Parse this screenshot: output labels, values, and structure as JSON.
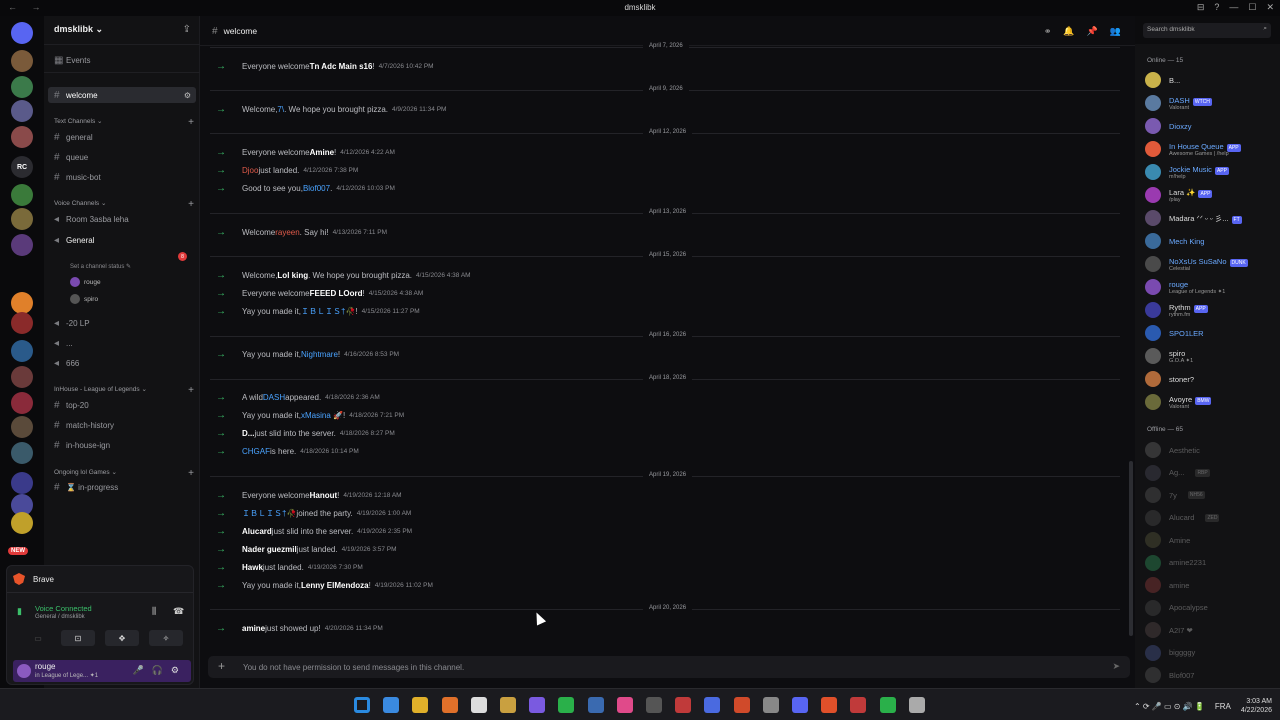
{
  "window": {
    "title": "dmsklibk",
    "nav": "← →",
    "controls": [
      "⊟",
      "?",
      "—",
      "☐",
      "✕"
    ]
  },
  "server": {
    "name": "dmsklibk ⌄",
    "new_badge": "NEW"
  },
  "server_icons": [
    {
      "label": "",
      "color": "#5865f2",
      "badge": ""
    },
    {
      "label": "",
      "color": "#7a5a3a",
      "badge": "4"
    },
    {
      "label": "",
      "color": "#3b7a4a",
      "badge": "7"
    },
    {
      "label": "",
      "color": "#5a5a8a",
      "badge": "6"
    },
    {
      "label": "",
      "color": "#8a4a4a",
      "badge": "4"
    },
    {
      "label": "RC",
      "color": "#2b2b30",
      "badge": ""
    },
    {
      "label": "",
      "color": "#3a7a3a",
      "badge": "1"
    },
    {
      "label": "",
      "color": "#7a6a3a",
      "badge": "3"
    },
    {
      "label": "",
      "color": "#5a3a7a",
      "badge": "1"
    },
    {
      "label": "",
      "color": "#e0802a",
      "badge": ""
    },
    {
      "label": "",
      "color": "#8a2a2a",
      "badge": "30"
    },
    {
      "label": "",
      "color": "#2a5a8a",
      "badge": "6"
    },
    {
      "label": "",
      "color": "#6a3a3a",
      "badge": "3"
    },
    {
      "label": "",
      "color": "#8a2a3a",
      "badge": "3"
    },
    {
      "label": "",
      "color": "#5a4a3a",
      "badge": "3"
    },
    {
      "label": "",
      "color": "#3a5a6a",
      "badge": "1"
    },
    {
      "label": "",
      "color": "#3a3a8a",
      "badge": "37"
    },
    {
      "label": "",
      "color": "#4a4a9a",
      "badge": "30"
    },
    {
      "label": "",
      "color": "#c0a02a",
      "badge": ""
    }
  ],
  "channels": {
    "events": "Events",
    "welcome": "welcome",
    "text_cat": "Text Channels ⌄",
    "text": [
      "general",
      "queue",
      "music-bot"
    ],
    "voice_cat": "Voice Channels ⌄",
    "room": "Room 3asba leha",
    "general_voice": "General",
    "general_badge": "8",
    "status": "Set a channel status ✎",
    "voice_users": [
      "rouge",
      "spiro"
    ],
    "lp": "-20 LP",
    "dots": "...",
    "six": "666",
    "inhouse_cat": "InHouse - League of Legends ⌄",
    "inhouse": [
      "top-20",
      "match-history",
      "in-house-ign"
    ],
    "ongoing_cat": "Ongoing lol Games ⌄",
    "in_progress": "⌛ in-progress"
  },
  "dock": {
    "brave": "Brave",
    "voice_connected": "Voice Connected",
    "voice_sub": "General / dmsklibk",
    "user_name": "rouge",
    "user_status": "in League of Lege... ✦1"
  },
  "chat": {
    "channel": "welcome",
    "search_placeholder": "Search dmsklibk",
    "input_placeholder": "You do not have permission to send messages in this channel.",
    "dividers": [
      "April 7, 2026",
      "April 9, 2026",
      "April 12, 2026",
      "April 13, 2026",
      "April 15, 2026",
      "April 16, 2026",
      "April 18, 2026",
      "April 19, 2026",
      "April 20, 2026"
    ],
    "messages": [
      {
        "pre": "Everyone welcome ",
        "who": "Tn Adc Main s16",
        "post": "!",
        "ts": "4/7/2026 10:42 PM"
      },
      {
        "pre": "Welcome, ",
        "who": "7\\",
        "post": ". We hope you brought pizza.",
        "ts": "4/9/2026 11:34 PM"
      },
      {
        "pre": "Everyone welcome ",
        "who": "Amine",
        "post": "!",
        "ts": "4/12/2026 4:22 AM"
      },
      {
        "pre": "",
        "who": "Djoo",
        "post": " just landed.",
        "ts": "4/12/2026 7:38 PM"
      },
      {
        "pre": "Good to see you, ",
        "who": "Blof007",
        "post": ".",
        "ts": "4/12/2026 10:03 PM"
      },
      {
        "pre": "Welcome ",
        "who": "rayeen",
        "post": ". Say hi!",
        "ts": "4/13/2026 7:11 PM"
      },
      {
        "pre": "Welcome, ",
        "who": "Lol king",
        "post": ". We hope you brought pizza.",
        "ts": "4/15/2026 4:38 AM"
      },
      {
        "pre": "Everyone welcome ",
        "who": "FEEED LOord",
        "post": "!",
        "ts": "4/15/2026 4:38 AM"
      },
      {
        "pre": "Yay you made it, ",
        "who": "ＩＢＬＩＳ†🥀",
        "post": "!",
        "ts": "4/15/2026 11:27 PM"
      },
      {
        "pre": "Yay you made it, ",
        "who": "Nightmare",
        "post": "!",
        "ts": "4/16/2026 8:53 PM"
      },
      {
        "pre": "A wild ",
        "who": "DASH",
        "post": " appeared.",
        "ts": "4/18/2026 2:36 AM"
      },
      {
        "pre": "Yay you made it, ",
        "who": "xMasina 🚀",
        "post": "!",
        "ts": "4/18/2026 7:21 PM"
      },
      {
        "pre": "",
        "who": "D...",
        "post": " just slid into the server.",
        "ts": "4/18/2026 8:27 PM"
      },
      {
        "pre": "",
        "who": "CHGAF",
        "post": " is here.",
        "ts": "4/18/2026 10:14 PM"
      },
      {
        "pre": "Everyone welcome ",
        "who": "Hanout",
        "post": "!",
        "ts": "4/19/2026 12:18 AM"
      },
      {
        "pre": "",
        "who": "ＩＢＬＩＳ†🥀",
        "post": " joined the party.",
        "ts": "4/19/2026 1:00 AM"
      },
      {
        "pre": "",
        "who": "Alucard",
        "post": " just slid into the server.",
        "ts": "4/19/2026 2:35 PM"
      },
      {
        "pre": "",
        "who": "Nader guezmil",
        "post": " just landed.",
        "ts": "4/19/2026 3:57 PM"
      },
      {
        "pre": "",
        "who": "Hawk",
        "post": " just landed.",
        "ts": "4/19/2026 7:30 PM"
      },
      {
        "pre": "Yay you made it, ",
        "who": "Lenny ElMendoza",
        "post": "!",
        "ts": "4/19/2026 11:02 PM"
      },
      {
        "pre": "",
        "who": "amine",
        "post": " just showed up!",
        "ts": "4/20/2026 11:34 PM"
      }
    ]
  },
  "members": {
    "online_header": "Online — 15",
    "online": [
      {
        "name": "B...",
        "sub": "",
        "tag": "",
        "color": "#c9b24a"
      },
      {
        "name": "DASH",
        "sub": "Valorant",
        "tag": "WTCH",
        "color": "#5a7aa0"
      },
      {
        "name": "Dioxzy",
        "sub": "",
        "tag": "",
        "color": "#7a5ab0"
      },
      {
        "name": "In House Queue",
        "sub": "Awesome Games | /help",
        "tag": "APP",
        "color": "#e05a3a"
      },
      {
        "name": "Jockie Music",
        "sub": "m!help",
        "tag": "APP",
        "color": "#3a8ab0"
      },
      {
        "name": "Lara ✨",
        "sub": "/play",
        "tag": "APP",
        "color": "#9a3ab0"
      },
      {
        "name": "Madara ᐟᐟ ᵕ ᵕ 彡...",
        "sub": "",
        "tag": "FT",
        "color": "#5a4a6a"
      },
      {
        "name": "Mech King",
        "sub": "",
        "tag": "",
        "color": "#3a6a9a"
      },
      {
        "name": "NoXsUs SuSaNo",
        "sub": "Celestial",
        "tag": "DUNK",
        "color": "#4a4a4a"
      },
      {
        "name": "rouge",
        "sub": "League of Legends ✦1",
        "tag": "",
        "color": "#7a4ab0"
      },
      {
        "name": "Rythm",
        "sub": "rythm.fm",
        "tag": "APP",
        "color": "#3a3a9a"
      },
      {
        "name": "SPO1LER",
        "sub": "",
        "tag": "",
        "color": "#2a5ab0"
      },
      {
        "name": "spiro",
        "sub": "G.O.A ✦1",
        "tag": "",
        "color": "#5a5a5a"
      },
      {
        "name": "stoner?",
        "sub": "",
        "tag": "",
        "color": "#b06a3a"
      },
      {
        "name": "Avoyre",
        "sub": "Valorant",
        "tag": "BMW",
        "color": "#6a6a3a"
      }
    ],
    "offline_header": "Offline — 65",
    "offline": [
      {
        "name": "Aesthetic",
        "tag": "",
        "color": "#777"
      },
      {
        "name": "Ag...",
        "tag": "RBP",
        "color": "#556"
      },
      {
        "name": "7y",
        "tag": "NH56",
        "color": "#666"
      },
      {
        "name": "Alucard",
        "tag": "ZED",
        "color": "#555"
      },
      {
        "name": "Amine",
        "tag": "",
        "color": "#664"
      },
      {
        "name": "amine2231",
        "tag": "",
        "color": "#3a6"
      },
      {
        "name": "amine",
        "tag": "",
        "color": "#a44"
      },
      {
        "name": "Apocalypse",
        "tag": "",
        "color": "#555"
      },
      {
        "name": "A2I7 ❤",
        "tag": "",
        "color": "#655"
      },
      {
        "name": "biggggy",
        "tag": "",
        "color": "#56a"
      },
      {
        "name": "Blof007",
        "tag": "",
        "color": "#666"
      }
    ]
  },
  "taskbar": {
    "lang": "FRA",
    "time": "3:03 AM",
    "date": "4/22/2026",
    "tray": "⌃ ⟳ 🎤 ▭ ⊙ 🔊 🔋"
  }
}
